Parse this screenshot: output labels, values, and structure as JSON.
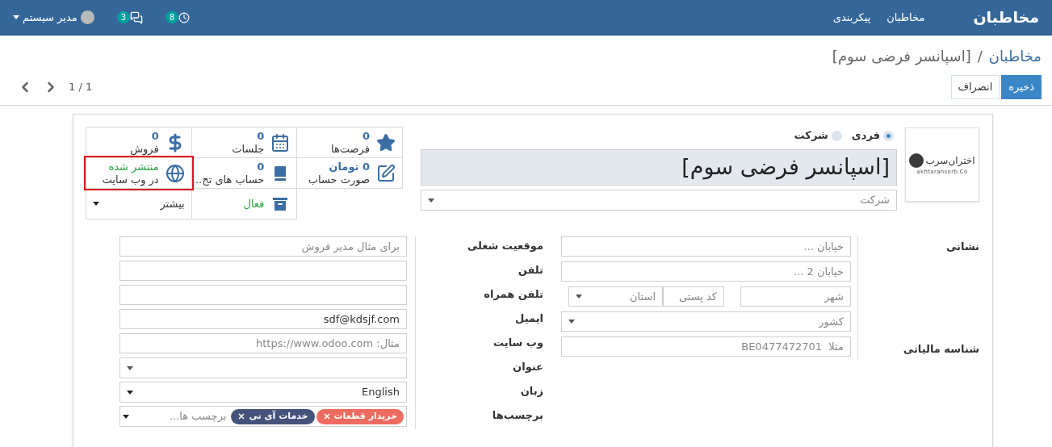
{
  "navbar": {
    "brand": "مخاطبان",
    "menu": [
      "مخاطبان",
      "پیکربندی"
    ],
    "activities_badge": "8",
    "messages_badge": "3",
    "user": "مدیر سیستم"
  },
  "breadcrumb": {
    "parent": "مخاطبان",
    "separator": "/",
    "current": "[اسپانسر فرضی سوم]"
  },
  "buttons": [
    {
      "label": "ذخیره",
      "kind": "primary"
    },
    {
      "label": "انصراف",
      "kind": "secondary"
    }
  ],
  "pager": "1 / 1",
  "smart_buttons": [
    {
      "kind": "star",
      "value": "0",
      "label": "فرصت‌ها",
      "highlighted": false
    },
    {
      "kind": "calendar",
      "value": "0",
      "label": "جلسات",
      "highlighted": false
    },
    {
      "kind": "dollar",
      "value": "0",
      "label": "فروش",
      "highlighted": false
    },
    {
      "kind": "edit",
      "value": "0 تومان",
      "label": "صورت حساب",
      "highlighted": false
    },
    {
      "kind": "book",
      "value": "0",
      "label": "حساب های تح...",
      "highlighted": false
    },
    {
      "kind": "globe",
      "status": "منتشر شده",
      "label": "در وب سایت",
      "highlighted": true
    },
    {
      "kind": "archive",
      "status": "فعال",
      "highlighted": false
    },
    {
      "kind": "more",
      "label": "بیشتر",
      "highlighted": false
    }
  ],
  "logo": {
    "name": "اختران‌سرب",
    "subtitle": "akhtaransorb.Co"
  },
  "company_type": [
    {
      "label": "فردی",
      "selected": true
    },
    {
      "label": "شرکت",
      "selected": false
    }
  ],
  "name": "[اسپانسر فرضی سوم]",
  "company": {
    "placeholder": "شرکت"
  },
  "address": {
    "label": "نشانی",
    "street": {
      "placeholder": "خیابان ..."
    },
    "street2": {
      "placeholder": "خیابان 2 ..."
    },
    "city": {
      "placeholder": "شهر"
    },
    "zip": {
      "placeholder": "کد پستی"
    },
    "state": {
      "placeholder": "استان"
    },
    "country": {
      "placeholder": "کشور"
    }
  },
  "tax_id": {
    "label": "شناسه مالیاتی",
    "placeholder": "مثلا  BE0477472701"
  },
  "fields": [
    {
      "label": "موقعیت شغلی",
      "kind": "text",
      "placeholder": "برای مثال مدیر فروش"
    },
    {
      "label": "تلفن",
      "kind": "text"
    },
    {
      "label": "تلفن همراه",
      "kind": "text"
    },
    {
      "label": "ایمیل",
      "kind": "text",
      "value": "sdf@kdsjf.com"
    },
    {
      "label": "وب سایت",
      "kind": "text",
      "placeholder": "مثال: https://www.odoo.com"
    },
    {
      "label": "عنوان",
      "kind": "select"
    },
    {
      "label": "زبان",
      "kind": "select",
      "value": "English"
    },
    {
      "label": "برچسب‌ها",
      "kind": "tags",
      "placeholder": "برچسب ها...",
      "tags": [
        {
          "label": "خریدار قطعات",
          "color": "#ee6b5f"
        },
        {
          "label": "خدمات آی تی",
          "color": "#45537b"
        }
      ]
    }
  ]
}
